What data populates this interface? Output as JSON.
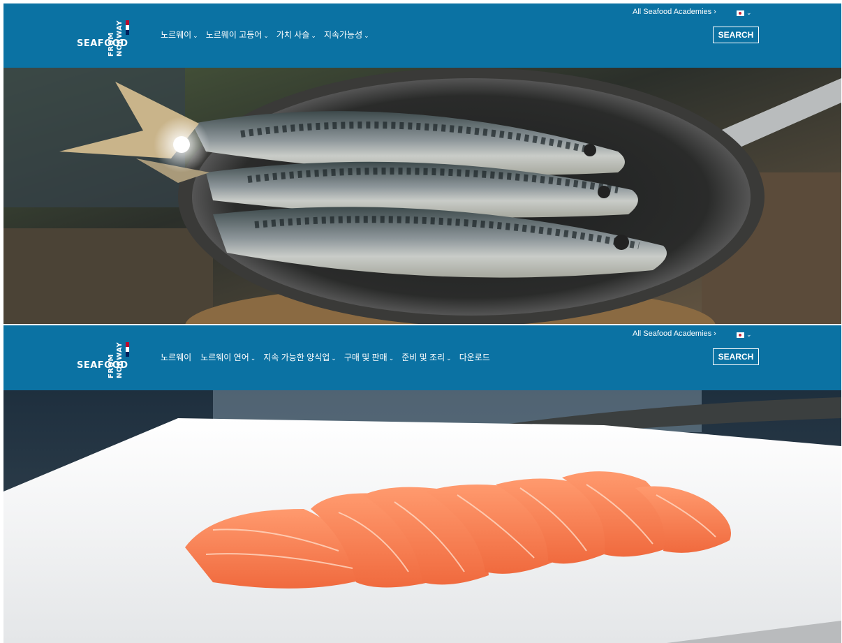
{
  "brand": {
    "wordmark": "SEAFOOD",
    "vertical_line1": "FROM",
    "vertical_line2": "NORWAY"
  },
  "site1": {
    "menu": [
      {
        "label": "노르웨이",
        "chevron": "⌄"
      },
      {
        "label": "노르웨이 고등어",
        "chevron": "⌄"
      },
      {
        "label": "가치 사슬",
        "chevron": "⌄"
      },
      {
        "label": "지속가능성",
        "chevron": "⌄"
      }
    ],
    "academies_link": "All Seafood Academies ›",
    "search_label": "SEARCH",
    "hero_image": "mackerel-in-pan"
  },
  "site2": {
    "menu": [
      {
        "label": "노르웨이",
        "chevron": ""
      },
      {
        "label": "노르웨이 연어",
        "chevron": "⌄"
      },
      {
        "label": "지속 가능한 양식업",
        "chevron": "⌄"
      },
      {
        "label": "구매 및 판매",
        "chevron": "⌄"
      },
      {
        "label": "준비 및 조리",
        "chevron": "⌄"
      },
      {
        "label": "다운로드",
        "chevron": ""
      }
    ],
    "academies_link": "All Seafood Academies ›",
    "search_label": "SEARCH",
    "hero_image": "salmon-sashimi-plate"
  },
  "colors": {
    "nav_bg": "#0b72a3",
    "flag_red": "#ba0c2f",
    "flag_blue": "#00205b"
  }
}
